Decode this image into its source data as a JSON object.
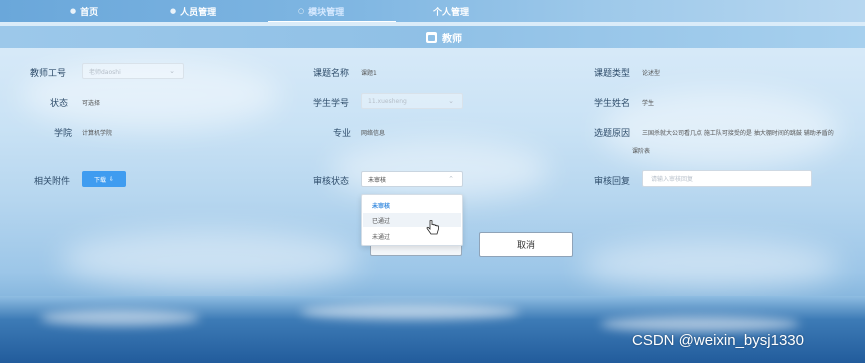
{
  "nav": {
    "items": [
      {
        "label": "首页",
        "icon": "home-dot-icon"
      },
      {
        "label": "人员管理",
        "icon": "user-dot-icon"
      },
      {
        "label": "模块管理",
        "icon": "module-dot-icon",
        "active": true
      },
      {
        "label": "个人管理",
        "icon": ""
      }
    ]
  },
  "subbar": {
    "title": "教师"
  },
  "form": {
    "teacher_id": {
      "label": "教师工号",
      "placeholder": "老师daoshi"
    },
    "topic_name": {
      "label": "课题名称",
      "value": "课题1"
    },
    "topic_type": {
      "label": "课题类型",
      "value": "论述型"
    },
    "status": {
      "label": "状态",
      "value": "可选择"
    },
    "student_id": {
      "label": "学生学号",
      "placeholder": "11.xuesheng"
    },
    "student_name": {
      "label": "学生姓名",
      "value": "学生"
    },
    "college": {
      "label": "学院",
      "value": "计算机学院"
    },
    "major": {
      "label": "专业",
      "value": "网络信息"
    },
    "reason": {
      "label": "选题原因",
      "value_line1": "三国杀就大公司看几点 施工队可接受的是 抽大棚时间的跳鼓 辅助矛盾的",
      "value_line2": "课阶表"
    },
    "attachment": {
      "label": "相关附件",
      "button": "下载"
    },
    "review_status": {
      "label": "审核状态",
      "value": "未审核",
      "options": [
        "未审核",
        "已通过",
        "未通过"
      ]
    },
    "review_reply": {
      "label": "审核回复",
      "placeholder": "请输入审核回复"
    }
  },
  "actions": {
    "cancel": "取消"
  },
  "watermark": "CSDN @weixin_bysj1330",
  "colors": {
    "accent": "#3f9cf0",
    "nav": "#7fb6e2"
  }
}
